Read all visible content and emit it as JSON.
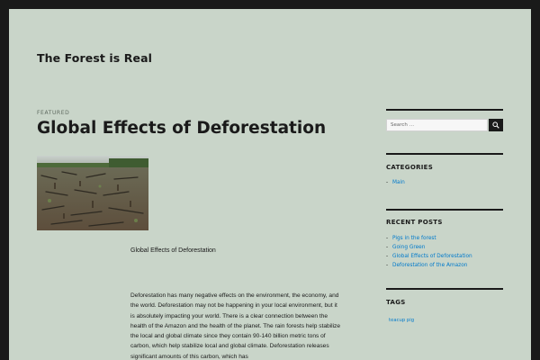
{
  "site": {
    "title": "The Forest is Real"
  },
  "post": {
    "label": "Featured",
    "title": "Global Effects of Deforestation",
    "image_alt": "Deforested land with burned tree stumps",
    "caption": "Global Effects of Deforestation",
    "body": "Deforestation has many negative effects on the environment, the economy, and the world. Deforestation may not be happening in your local environment, but it is absolutely impacting your world. There is a clear connection between the health of the Amazon and the health of the planet. The rain forests help stabilize the local and global climate since they contain 90-140 billion metric tons of carbon, which help stabilize local and global climate. Deforestation releases significant amounts of this carbon, which has"
  },
  "sidebar": {
    "search": {
      "placeholder": "Search …"
    },
    "categories": {
      "title": "Categories",
      "items": [
        "Main"
      ]
    },
    "recent_posts": {
      "title": "Recent Posts",
      "items": [
        "Pigs in the forest",
        "Going Green",
        "Global Effects of Deforestation",
        "Deforestation of the Amazon"
      ]
    },
    "tags": {
      "title": "Tags",
      "items": [
        "teacup pig"
      ]
    }
  },
  "colors": {
    "frame": "#1a1a1a",
    "background": "#c9d5c9",
    "text": "#1a1a1a",
    "link": "#007acc"
  }
}
